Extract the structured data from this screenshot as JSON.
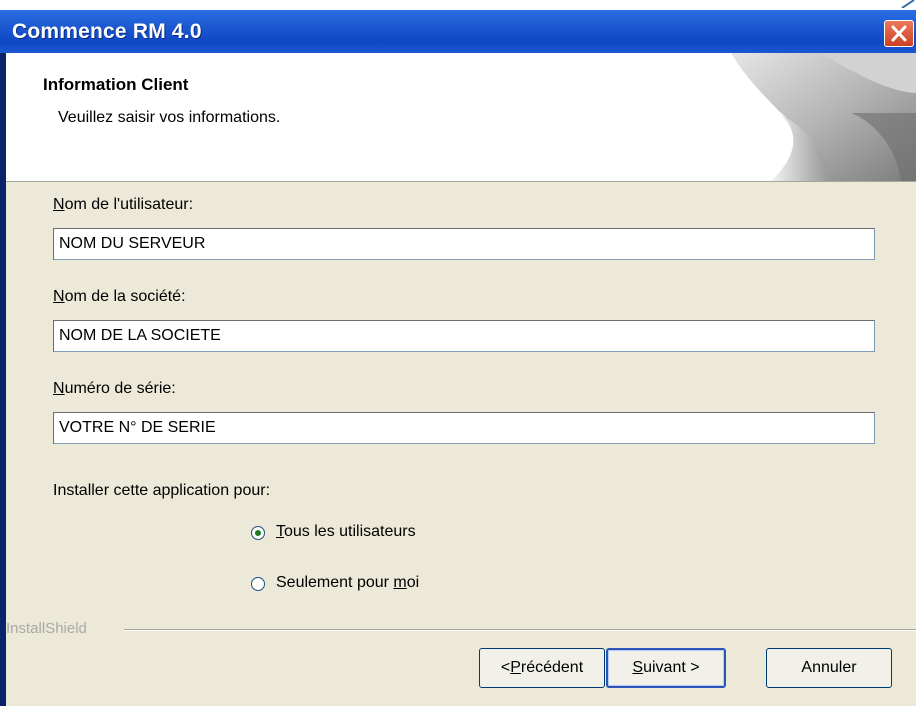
{
  "window": {
    "title": "Commence RM 4.0",
    "close_icon": "close-icon"
  },
  "header": {
    "title": "Information Client",
    "subtitle": "Veuillez saisir vos informations."
  },
  "form": {
    "user_label": {
      "accel": "N",
      "rest": "om de l'utilisateur:"
    },
    "user_value": "NOM DU SERVEUR",
    "company_label": {
      "accel": "N",
      "rest": "om de la société:"
    },
    "company_value": "NOM DE LA SOCIETE",
    "serial_label": {
      "accel": "N",
      "rest": "uméro de série:"
    },
    "serial_value": "VOTRE N° DE SERIE",
    "install_for_label": "Installer cette application pour:",
    "option_all": {
      "accel": "T",
      "rest": "ous les utilisateurs",
      "selected": true
    },
    "option_me": {
      "before": "Seulement pour ",
      "accel": "m",
      "rest": "oi",
      "selected": false
    }
  },
  "footer": {
    "brand": "InstallShield",
    "back": {
      "before": "< ",
      "accel": "P",
      "rest": "récédent"
    },
    "next": {
      "accel": "S",
      "rest": "uivant >"
    },
    "cancel": "Annuler"
  },
  "colors": {
    "titlebar": "#1b58d0",
    "panel": "#ece9d8",
    "close": "#cf3f21"
  }
}
